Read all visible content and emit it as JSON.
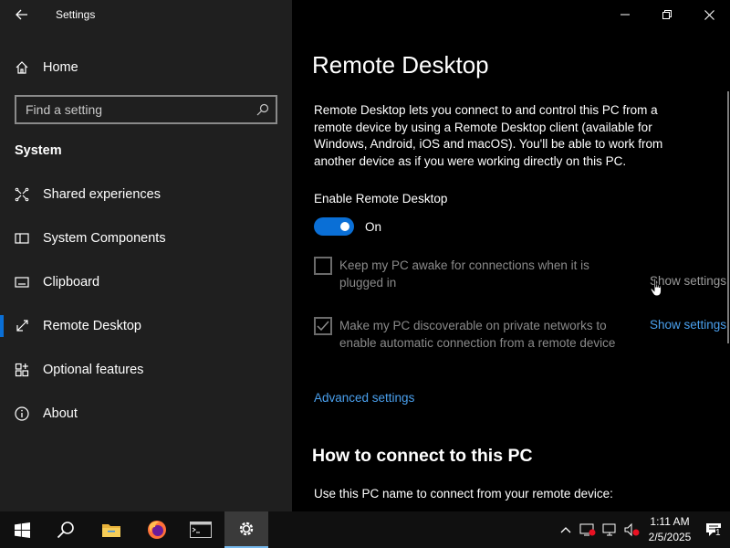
{
  "window": {
    "title": "Settings"
  },
  "sidebar": {
    "home_label": "Home",
    "search": {
      "placeholder": "Find a setting"
    },
    "section": "System",
    "items": [
      {
        "label": "Shared experiences",
        "icon": "shared-experiences-icon"
      },
      {
        "label": "System Components",
        "icon": "system-components-icon"
      },
      {
        "label": "Clipboard",
        "icon": "clipboard-icon"
      },
      {
        "label": "Remote Desktop",
        "icon": "remote-desktop-icon",
        "active": true
      },
      {
        "label": "Optional features",
        "icon": "optional-features-icon"
      },
      {
        "label": "About",
        "icon": "info-icon"
      }
    ]
  },
  "main": {
    "title": "Remote Desktop",
    "description": "Remote Desktop lets you connect to and control this PC from a remote device by using a Remote Desktop client (available for Windows, Android, iOS and macOS). You'll be able to work from another device as if you were working directly on this PC.",
    "enable_label": "Enable Remote Desktop",
    "toggle": {
      "state": "On",
      "on": true
    },
    "options": [
      {
        "text": "Keep my PC awake for connections when it is plugged in",
        "checked": false,
        "link": "Show settings"
      },
      {
        "text": "Make my PC discoverable on private networks to enable automatic connection from a remote device",
        "checked": true,
        "link": "Show settings"
      }
    ],
    "advanced_link": "Advanced settings",
    "section_title": "How to connect to this PC",
    "connect_text": "Use this PC name to connect from your remote device:"
  },
  "taskbar": {
    "apps": [
      "start-icon",
      "search-icon",
      "file-explorer-icon",
      "firefox-icon",
      "terminal-icon",
      "settings-gear-icon"
    ],
    "clock": {
      "time": "1:11 AM",
      "date": "2/5/2025"
    },
    "notification_count": "1"
  },
  "colors": {
    "accent": "#0a6fd6",
    "link": "#4aa0ee",
    "sidebar_bg": "#1f1f1f",
    "content_bg": "#000000"
  }
}
